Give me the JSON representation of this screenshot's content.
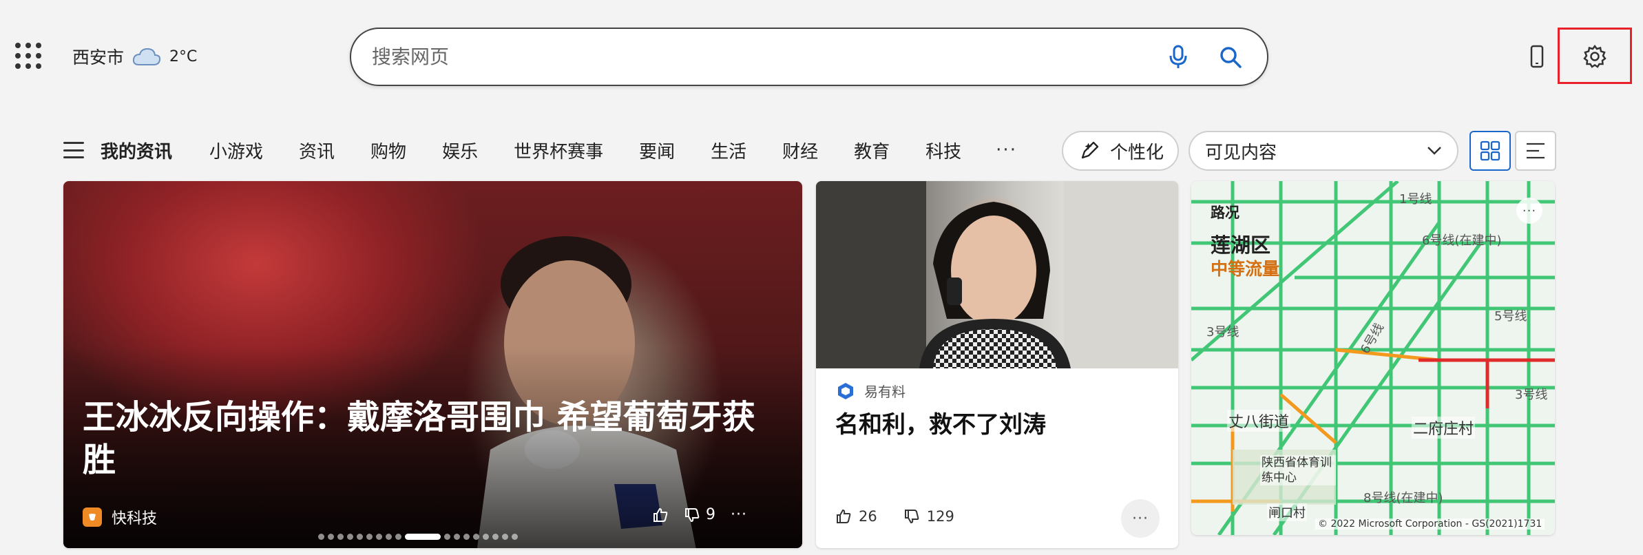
{
  "header": {
    "city": "西安市",
    "temperature": "2°C",
    "search_placeholder": "搜索网页"
  },
  "nav": {
    "items": [
      "我的资讯",
      "小游戏",
      "资讯",
      "购物",
      "娱乐",
      "世界杯赛事",
      "要闻",
      "生活",
      "财经",
      "教育",
      "科技"
    ],
    "more": "···",
    "personalize": "个性化",
    "visible_content": "可见内容"
  },
  "hero": {
    "title": "王冰冰反向操作：戴摩洛哥围巾 希望葡萄牙获胜",
    "source": "快科技",
    "dislikes": "9",
    "more": "···",
    "page_count": 18,
    "active_page": 9
  },
  "article": {
    "source": "易有料",
    "title": "名和利，救不了刘涛",
    "likes": "26",
    "dislikes": "129",
    "more": "···"
  },
  "traffic": {
    "label": "路况",
    "district": "莲湖区",
    "status": "中等流量",
    "status_color": "#d46f12",
    "more": "···",
    "places": [
      "丈八街道",
      "二府庄村",
      "陕西省体育训练中心",
      "闸口村"
    ],
    "roads": [
      "1号线",
      "6号线(在建中)",
      "5号线",
      "3号线",
      "6号线",
      "3号线",
      "8号线(在建中)"
    ],
    "copyright": "© 2022 Microsoft Corporation - GS(2021)1731"
  },
  "colors": {
    "accent": "#1a66c9",
    "highlight_box": "#e8202a",
    "source_orange": "#f08a24"
  }
}
